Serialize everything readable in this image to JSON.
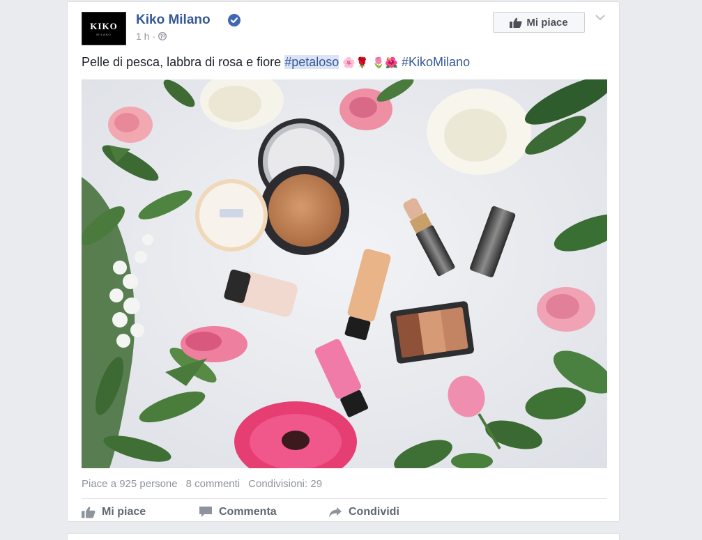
{
  "post": {
    "page_name": "Kiko Milano",
    "avatar_logo": "KIKO",
    "avatar_logo_sub": "MILANO",
    "timestamp": "1 h",
    "separator": "·",
    "like_page_label": "Mi piace",
    "text_prefix": "Pelle di pesca, labbra di rosa e fiore",
    "hashtag_1": "#petaloso",
    "emoji_group_1": "🌸🌹",
    "emoji_group_2": "🌷🌺",
    "hashtag_2": "#KikoMilano"
  },
  "stats": {
    "likes": "Piace a 925 persone",
    "comments": "8 commenti",
    "shares": "Condivisioni: 29"
  },
  "actions": {
    "like": "Mi piace",
    "comment": "Commenta",
    "share": "Condividi"
  },
  "colors": {
    "link": "#365899",
    "background": "#e9ebee",
    "verified": "#4267b2",
    "muted": "#90949c"
  },
  "icons": [
    "verified-badge-icon",
    "globe-icon",
    "thumbs-up-icon",
    "chevron-down-icon",
    "comment-icon",
    "share-icon"
  ]
}
